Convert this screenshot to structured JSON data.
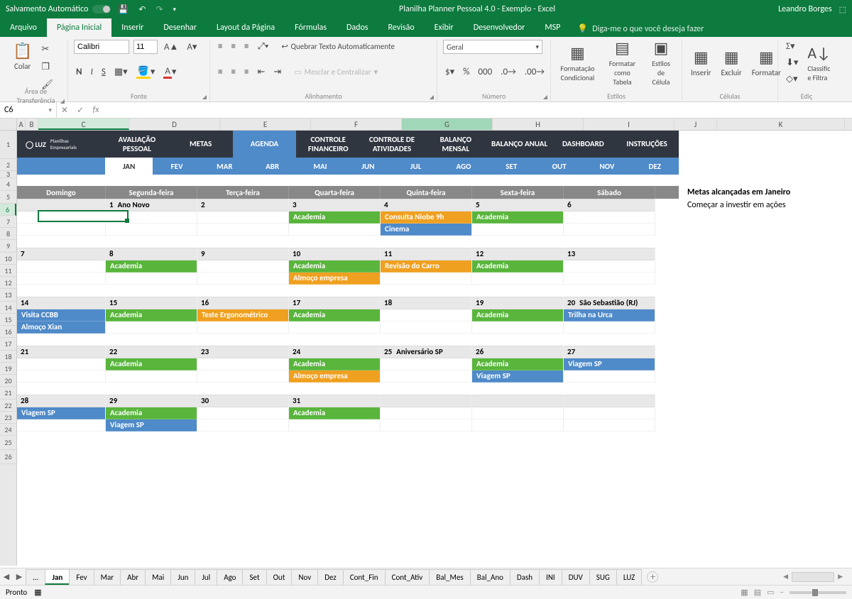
{
  "titlebar": {
    "autosave": "Salvamento Automático",
    "title": "Planilha Planner Pessoal 4.0 - Exemplo  -  Excel",
    "user": "Leandro Borges"
  },
  "menu": {
    "file": "Arquivo",
    "home": "Página Inicial",
    "insert": "Inserir",
    "draw": "Desenhar",
    "layout": "Layout da Página",
    "formulas": "Fórmulas",
    "data": "Dados",
    "review": "Revisão",
    "view": "Exibir",
    "dev": "Desenvolvedor",
    "msp": "MSP",
    "tell": "Diga-me o que você deseja fazer"
  },
  "ribbon": {
    "paste": "Colar",
    "clipboard": "Área de Transferência",
    "font": "Fonte",
    "fontname": "Calibri",
    "fontsize": "11",
    "alignment": "Alinhamento",
    "wrap": "Quebrar Texto Automaticamente",
    "merge": "Mesclar e Centralizar",
    "number": "Número",
    "numfmt": "Geral",
    "condfmt": "Formatação Condicional",
    "fmttable": "Formatar como Tabela",
    "cellstyles": "Estilos de Célula",
    "styles": "Estilos",
    "insert": "Inserir",
    "delete": "Excluir",
    "format": "Formatar",
    "cells": "Células",
    "sort": "Classific e Filtra",
    "editing": "Ediç"
  },
  "namebox": "C6",
  "colhdrs": [
    "A",
    "B",
    "C",
    "D",
    "E",
    "F",
    "G",
    "H",
    "I",
    "J",
    "K"
  ],
  "rowhdrs": [
    "1",
    "2",
    "3",
    "4",
    "5",
    "6",
    "7",
    "8",
    "9",
    "10",
    "11",
    "12",
    "13",
    "14",
    "15",
    "16",
    "17",
    "18",
    "19",
    "20",
    "21",
    "22",
    "23",
    "24",
    "25",
    "26"
  ],
  "nav": [
    "AVALIAÇÃO PESSOAL",
    "METAS",
    "AGENDA",
    "CONTROLE FINANCEIRO",
    "CONTROLE DE ATIVIDADES",
    "BALANÇO MENSAL",
    "BALANÇO ANUAL",
    "DASHBOARD",
    "INSTRUÇÕES"
  ],
  "navActive": 2,
  "months": [
    "JAN",
    "FEV",
    "MAR",
    "ABR",
    "MAI",
    "JUN",
    "JUL",
    "AGO",
    "SET",
    "OUT",
    "NOV",
    "DEZ"
  ],
  "monthActive": 0,
  "weekdays": [
    "Domingo",
    "Segunda-feira",
    "Terça-feira",
    "Quarta-feira",
    "Quinta-feira",
    "Sexta-feira",
    "Sábado"
  ],
  "side": {
    "title": "Metas alcançadas em Janeiro",
    "item": "Começar a investir em ações"
  },
  "calendar": [
    [
      {
        "n": "",
        "ev": []
      },
      {
        "n": "1",
        "t": "Ano Novo",
        "ev": []
      },
      {
        "n": "2",
        "ev": []
      },
      {
        "n": "3",
        "ev": [
          {
            "c": "green",
            "l": "Academia"
          }
        ]
      },
      {
        "n": "4",
        "ev": [
          {
            "c": "orange",
            "l": "Consulta Niobe 9h"
          },
          {
            "c": "blue",
            "l": "Cinema"
          }
        ]
      },
      {
        "n": "5",
        "ev": [
          {
            "c": "green",
            "l": "Academia"
          }
        ]
      },
      {
        "n": "6",
        "ev": []
      }
    ],
    [
      {
        "n": "7",
        "ev": []
      },
      {
        "n": "8",
        "ev": [
          {
            "c": "green",
            "l": "Academia"
          }
        ]
      },
      {
        "n": "9",
        "ev": []
      },
      {
        "n": "10",
        "ev": [
          {
            "c": "green",
            "l": "Academia"
          },
          {
            "c": "orange",
            "l": "Almoço empresa"
          }
        ]
      },
      {
        "n": "11",
        "ev": [
          {
            "c": "orange",
            "l": "Revisão do Carro"
          }
        ]
      },
      {
        "n": "12",
        "ev": [
          {
            "c": "green",
            "l": "Academia"
          }
        ]
      },
      {
        "n": "13",
        "ev": []
      }
    ],
    [
      {
        "n": "14",
        "ev": [
          {
            "c": "blue",
            "l": "Visita CCBB"
          },
          {
            "c": "blue",
            "l": "Almoço Xian"
          }
        ]
      },
      {
        "n": "15",
        "ev": [
          {
            "c": "green",
            "l": "Academia"
          }
        ]
      },
      {
        "n": "16",
        "ev": [
          {
            "c": "orange",
            "l": "Teste Ergonométrico"
          }
        ]
      },
      {
        "n": "17",
        "ev": [
          {
            "c": "green",
            "l": "Academia"
          }
        ]
      },
      {
        "n": "18",
        "ev": []
      },
      {
        "n": "19",
        "ev": [
          {
            "c": "green",
            "l": "Academia"
          }
        ]
      },
      {
        "n": "20",
        "t": "São Sebastião (RJ)",
        "ev": [
          {
            "c": "blue",
            "l": "Trilha na Urca"
          }
        ]
      }
    ],
    [
      {
        "n": "21",
        "ev": []
      },
      {
        "n": "22",
        "ev": [
          {
            "c": "green",
            "l": "Academia"
          }
        ]
      },
      {
        "n": "23",
        "ev": []
      },
      {
        "n": "24",
        "ev": [
          {
            "c": "green",
            "l": "Academia"
          },
          {
            "c": "orange",
            "l": "Almoço empresa"
          }
        ]
      },
      {
        "n": "25",
        "t": "Aniversário SP",
        "ev": []
      },
      {
        "n": "26",
        "ev": [
          {
            "c": "green",
            "l": "Academia"
          },
          {
            "c": "blue",
            "l": "Viagem SP"
          }
        ]
      },
      {
        "n": "27",
        "ev": [
          {
            "c": "blue",
            "l": "Viagem SP"
          }
        ]
      }
    ],
    [
      {
        "n": "28",
        "ev": [
          {
            "c": "blue",
            "l": "Viagem SP"
          }
        ]
      },
      {
        "n": "29",
        "ev": [
          {
            "c": "green",
            "l": "Academia"
          },
          {
            "c": "blue",
            "l": "Viagem SP"
          }
        ]
      },
      {
        "n": "30",
        "ev": []
      },
      {
        "n": "31",
        "ev": [
          {
            "c": "green",
            "l": "Academia"
          }
        ]
      },
      {
        "n": "",
        "ev": []
      },
      {
        "n": "",
        "ev": []
      },
      {
        "n": "",
        "ev": []
      }
    ]
  ],
  "sheettabs": [
    "...",
    "Jan",
    "Fev",
    "Mar",
    "Abr",
    "Mai",
    "Jun",
    "Jul",
    "Ago",
    "Set",
    "Out",
    "Nov",
    "Dez",
    "Cont_Fin",
    "Cont_Ativ",
    "Bal_Mes",
    "Bal_Ano",
    "Dash",
    "INI",
    "DUV",
    "SUG",
    "LUZ"
  ],
  "sheetActive": 1,
  "status": "Pronto"
}
